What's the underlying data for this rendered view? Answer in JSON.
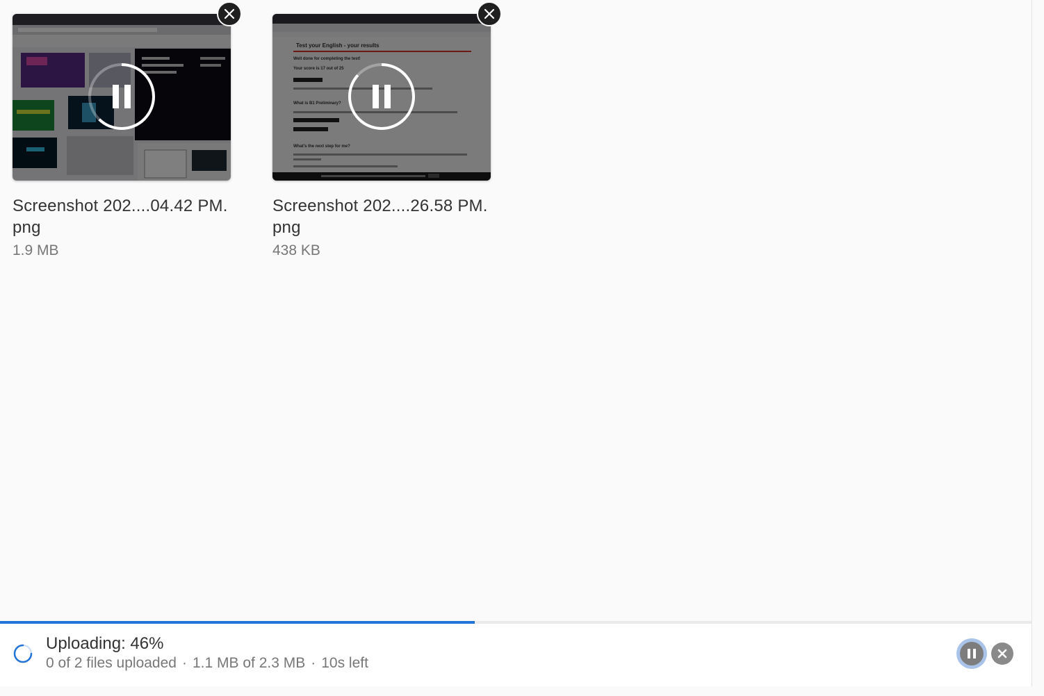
{
  "files": [
    {
      "name": "Screenshot 202....04.42 PM.png",
      "size": "1.9 MB",
      "state": "paused",
      "remove_icon": "close-icon",
      "status_icon": "pause-icon"
    },
    {
      "name": "Screenshot 202....26.58 PM.png",
      "size": "438 KB",
      "state": "paused",
      "remove_icon": "close-icon",
      "status_icon": "pause-icon",
      "thumbnail_text": {
        "heading": "Test your English - your results",
        "line1": "Well done for completing the test!",
        "line2": "Your score is 17 out of 25",
        "section": "What is B1 Preliminary?",
        "section2": "What's the next step for me?"
      }
    }
  ],
  "status": {
    "title": "Uploading: 46%",
    "progress_percent": 46,
    "files_uploaded": "0 of 2 files uploaded",
    "bytes": "1.1 MB of 2.3 MB",
    "time_left": "10s left",
    "separator": "·",
    "pause_icon": "pause-icon",
    "cancel_icon": "close-icon",
    "spinner_icon": "spinner-icon"
  },
  "colors": {
    "accent": "#2275d7",
    "background": "#fafafa"
  }
}
